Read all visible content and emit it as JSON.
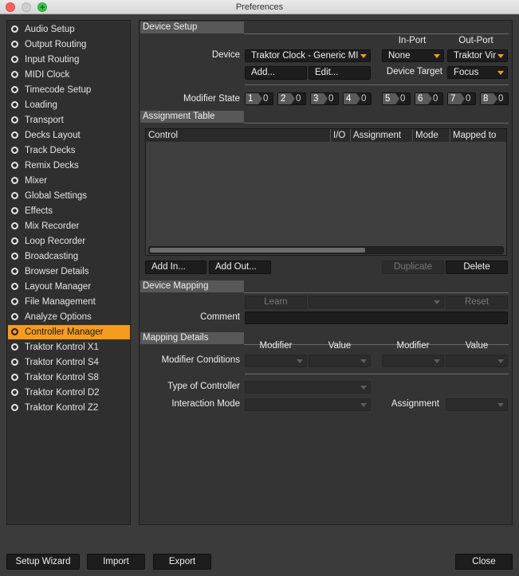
{
  "window": {
    "title": "Preferences"
  },
  "sidebar": {
    "items": [
      {
        "label": "Audio Setup",
        "active": false
      },
      {
        "label": "Output Routing",
        "active": false
      },
      {
        "label": "Input Routing",
        "active": false
      },
      {
        "label": "MIDI Clock",
        "active": false
      },
      {
        "label": "Timecode Setup",
        "active": false
      },
      {
        "label": "Loading",
        "active": false
      },
      {
        "label": "Transport",
        "active": false
      },
      {
        "label": "Decks Layout",
        "active": false
      },
      {
        "label": "Track Decks",
        "active": false
      },
      {
        "label": "Remix Decks",
        "active": false
      },
      {
        "label": "Mixer",
        "active": false
      },
      {
        "label": "Global Settings",
        "active": false
      },
      {
        "label": "Effects",
        "active": false
      },
      {
        "label": "Mix Recorder",
        "active": false
      },
      {
        "label": "Loop Recorder",
        "active": false
      },
      {
        "label": "Broadcasting",
        "active": false
      },
      {
        "label": "Browser Details",
        "active": false
      },
      {
        "label": "Layout Manager",
        "active": false
      },
      {
        "label": "File Management",
        "active": false
      },
      {
        "label": "Analyze Options",
        "active": false
      },
      {
        "label": "Controller Manager",
        "active": true
      },
      {
        "label": "Traktor Kontrol X1",
        "active": false
      },
      {
        "label": "Traktor Kontrol S4",
        "active": false
      },
      {
        "label": "Traktor Kontrol S8",
        "active": false
      },
      {
        "label": "Traktor Kontrol D2",
        "active": false
      },
      {
        "label": "Traktor Kontrol Z2",
        "active": false
      }
    ]
  },
  "device_setup": {
    "header": "Device Setup",
    "in_port_label": "In-Port",
    "out_port_label": "Out-Port",
    "device_label": "Device",
    "device_value": "Traktor Clock - Generic MIDI",
    "in_port_value": "None",
    "out_port_value": "Traktor Virtual Output",
    "add_button": "Add...",
    "edit_button": "Edit...",
    "device_target_label": "Device Target",
    "device_target_value": "Focus",
    "modifier_state_label": "Modifier State",
    "modifiers": [
      {
        "num": "1",
        "value": "0"
      },
      {
        "num": "2",
        "value": "0"
      },
      {
        "num": "3",
        "value": "0"
      },
      {
        "num": "4",
        "value": "0"
      },
      {
        "num": "5",
        "value": "0"
      },
      {
        "num": "6",
        "value": "0"
      },
      {
        "num": "7",
        "value": "0"
      },
      {
        "num": "8",
        "value": "0"
      }
    ]
  },
  "assignment_table": {
    "header": "Assignment Table",
    "columns": [
      "Control",
      "I/O",
      "Assignment",
      "Mode",
      "Mapped to"
    ],
    "rows": [],
    "add_in_button": "Add In...",
    "add_out_button": "Add Out...",
    "duplicate_button": "Duplicate",
    "delete_button": "Delete"
  },
  "device_mapping": {
    "header": "Device Mapping",
    "learn_button": "Learn",
    "reset_button": "Reset",
    "comment_label": "Comment",
    "comment_value": ""
  },
  "mapping_details": {
    "header": "Mapping Details",
    "modifier_label_1": "Modifier",
    "value_label_1": "Value",
    "modifier_label_2": "Modifier",
    "value_label_2": "Value",
    "modifier_conditions_label": "Modifier Conditions",
    "type_of_controller_label": "Type of Controller",
    "interaction_mode_label": "Interaction Mode",
    "assignment_label": "Assignment"
  },
  "footer": {
    "setup_wizard": "Setup Wizard",
    "import": "Import",
    "export": "Export",
    "close": "Close"
  },
  "colors": {
    "accent": "#f59b1e",
    "panel": "#343434",
    "background": "#3b3b3b"
  }
}
